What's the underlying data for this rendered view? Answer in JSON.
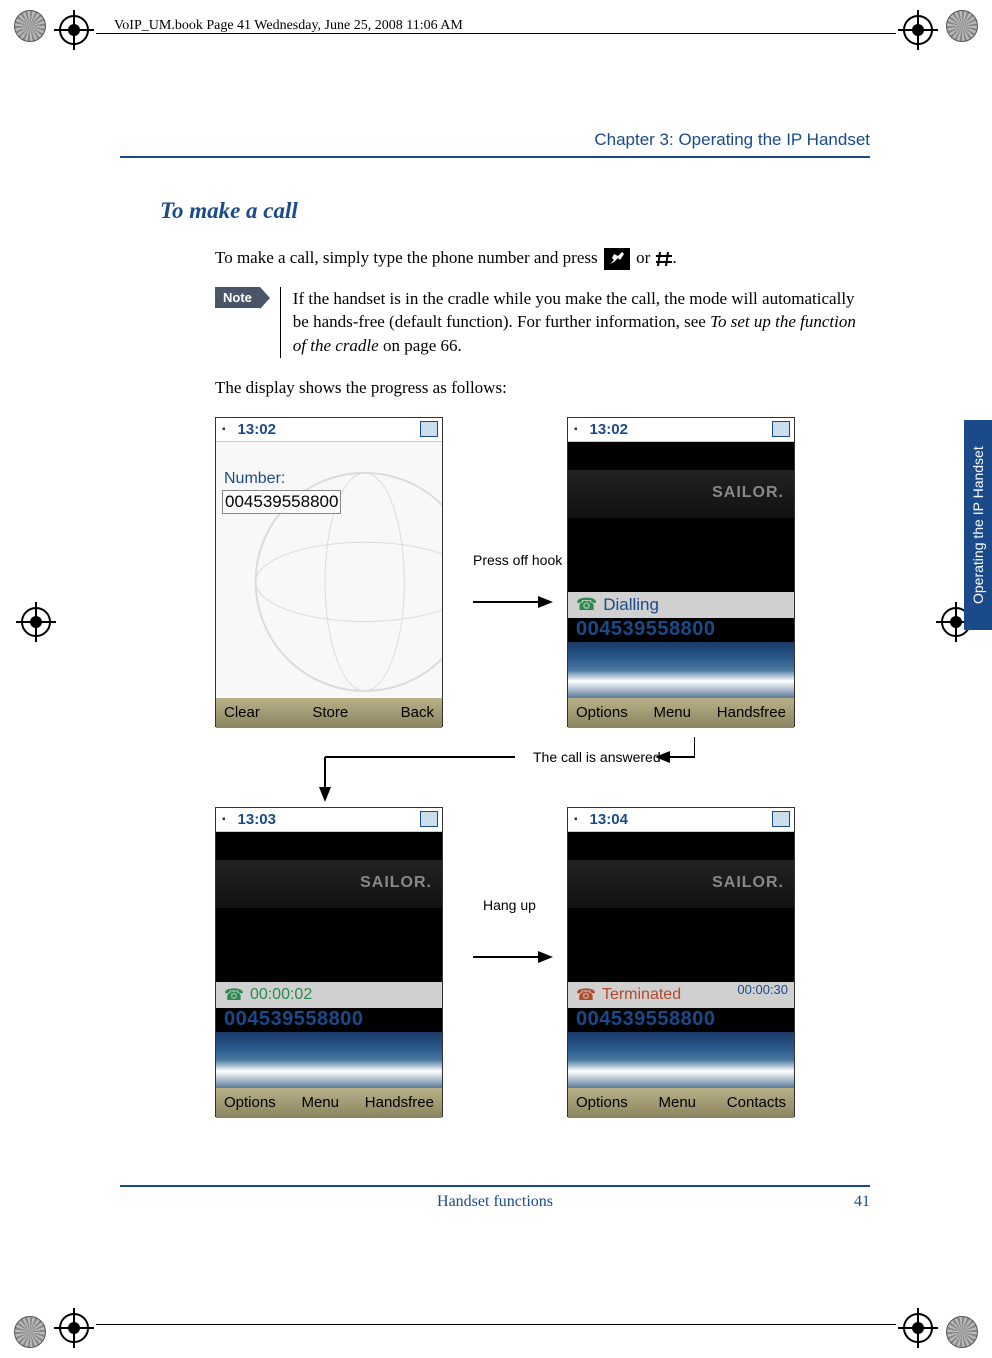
{
  "header_text": "VoIP_UM.book  Page 41  Wednesday, June 25, 2008  11:06 AM",
  "chapter_header": "Chapter 3:  Operating the IP Handset",
  "section_title": "To make a call",
  "intro_pre": "To make a call, simply type the phone number and press ",
  "intro_or": " or  ",
  "intro_hash": "#",
  "intro_post": ".",
  "note_label": "Note",
  "note_text_1": "If the handset is in the cradle while you make the call, the mode will automatically be hands-free (default function). For further information, see ",
  "note_text_italic": "To set up the function of the cradle",
  "note_text_2": " on page 66.",
  "progress_text": "The display shows the progress as follows:",
  "annotations": {
    "press_off_hook": "Press off hook",
    "call_answered": "The call is answered",
    "hang_up": "Hang up"
  },
  "phones": {
    "s1": {
      "time": "13:02",
      "number_label": "Number:",
      "number_value": "004539558800",
      "soft_left": "Clear",
      "soft_center": "Store",
      "soft_right": "Back"
    },
    "s2": {
      "time": "13:02",
      "brand": "SAILOR.",
      "status_text": "Dialling",
      "number": "004539558800",
      "soft_left": "Options",
      "soft_center": "Menu",
      "soft_right": "Handsfree"
    },
    "s3": {
      "time": "13:03",
      "brand": "SAILOR.",
      "duration": "00:00:02",
      "number": "004539558800",
      "soft_left": "Options",
      "soft_center": "Menu",
      "soft_right": "Handsfree"
    },
    "s4": {
      "time": "13:04",
      "brand": "SAILOR.",
      "status_text": "Terminated",
      "duration": "00:00:30",
      "number": "004539558800",
      "soft_left": "Options",
      "soft_center": "Menu",
      "soft_right": "Contacts"
    }
  },
  "side_tab": "Operating the IP Handset",
  "footer_center": "Handset functions",
  "page_number": "41"
}
